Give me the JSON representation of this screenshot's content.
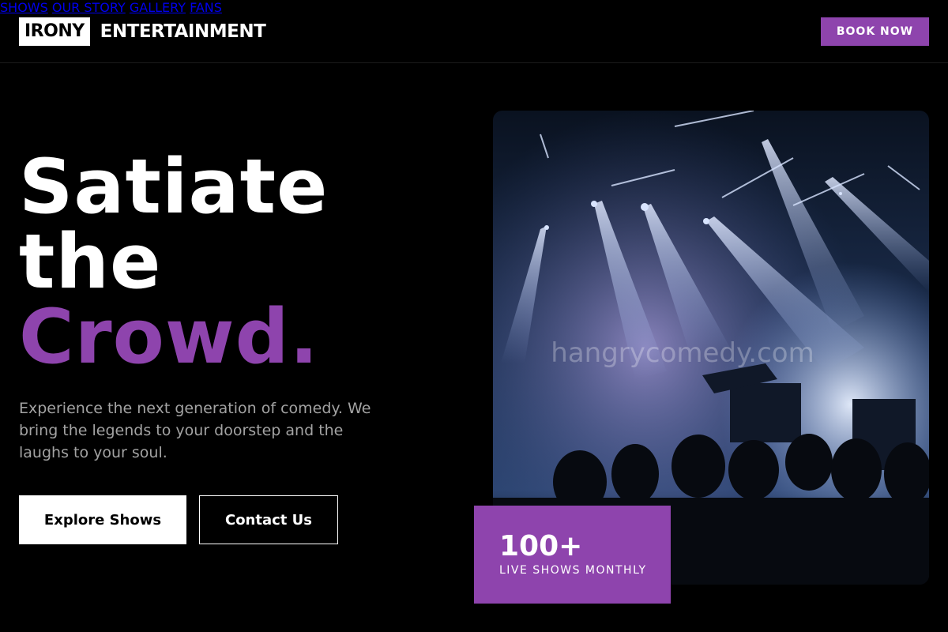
{
  "brand": {
    "box": "IRONY",
    "name": "ENTERTAINMENT"
  },
  "nav": {
    "items": [
      "SHOWS",
      "OUR STORY",
      "GALLERY",
      "FANS"
    ],
    "cta": "BOOK NOW"
  },
  "hero": {
    "line1": "Satiate",
    "line2": "the",
    "line3": "Crowd.",
    "description": "Experience the next generation of comedy. We bring the legends to your doorstep and the laughs to your soul.",
    "primary_button": "Explore Shows",
    "secondary_button": "Contact Us"
  },
  "photo": {
    "watermark": "hangrycomedy.com"
  },
  "stat": {
    "number": "100+",
    "label": "LIVE SHOWS MONTHLY"
  },
  "colors": {
    "accent": "#8e44ad",
    "background": "#000000",
    "muted_text": "#a3a3a3"
  }
}
